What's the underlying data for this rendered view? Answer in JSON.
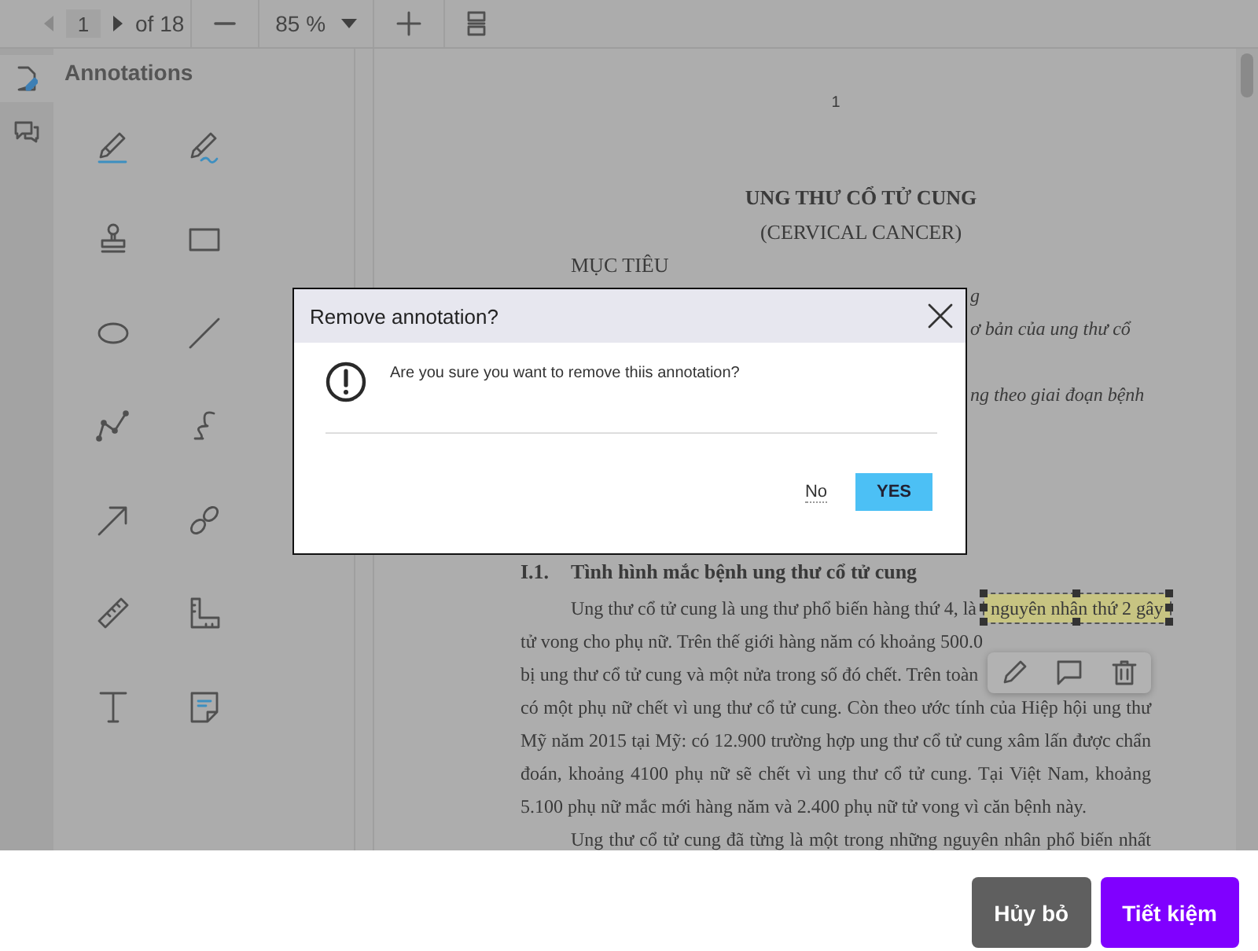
{
  "toolbar": {
    "page": "1",
    "page_count": "of 18",
    "zoom": "85 %"
  },
  "sidebar": {
    "title": "Annotations",
    "rail": [
      {
        "kind": "annotations",
        "selected": true
      },
      {
        "kind": "comments",
        "selected": false
      }
    ]
  },
  "document": {
    "page_number": "1",
    "title": "UNG THƯ CỔ TỬ CUNG",
    "subtitle": "(CERVICAL CANCER)",
    "section": "MỤC TIÊU",
    "fragments": [
      {
        "text": "g"
      },
      {
        "text": "ơ bản của ung thư cổ"
      },
      {
        "text": "ng theo giai đoạn bệnh"
      }
    ],
    "heading_number": "I.1.",
    "heading": "Tình hình mắc bệnh ung thư cổ tử cung",
    "lines": [
      {
        "kind": "first",
        "text": "Ung thư cổ tử cung là ung thư phổ biến hàng thứ 4, là ",
        "highlight": "nguyên nhân thứ 2 gây"
      },
      {
        "kind": "cut",
        "text": "tử vong cho phụ nữ. Trên thế giới hàng năm có khoảng 500.0"
      },
      {
        "kind": "cut",
        "text": "bị ung thư cổ tử cung và một nửa trong số đó chết. Trên toàn"
      },
      {
        "kind": "line",
        "text": "có một phụ nữ chết vì ung thư cổ tử cung. Còn theo ước tính của Hiệp hội ung thư"
      },
      {
        "kind": "line",
        "text": "Mỹ năm 2015 tại Mỹ: có 12.900 trường hợp ung thư cổ tử cung xâm lấn được chẩn"
      },
      {
        "kind": "line",
        "text": "đoán, khoảng 4100 phụ nữ sẽ chết vì ung thư cổ tử cung. Tại Việt Nam, khoảng"
      },
      {
        "kind": "last",
        "text": "5.100 phụ nữ mắc mới hàng năm và 2.400 phụ nữ tử vong vì căn bệnh này."
      },
      {
        "kind": "first",
        "text": "Ung thư cổ tử cung đã từng là một trong những nguyên nhân phổ biến nhất"
      }
    ]
  },
  "dialog": {
    "title": "Remove annotation?",
    "message": "Are you sure you want to remove thiis annotation?",
    "buttons": [
      {
        "label": "No",
        "kind": "link"
      },
      {
        "label": "YES",
        "kind": "primary"
      }
    ]
  },
  "footer": {
    "buttons": [
      {
        "label": "Hủy bỏ",
        "kind": "secondary"
      },
      {
        "label": "Tiết kiệm",
        "kind": "primary"
      }
    ]
  }
}
